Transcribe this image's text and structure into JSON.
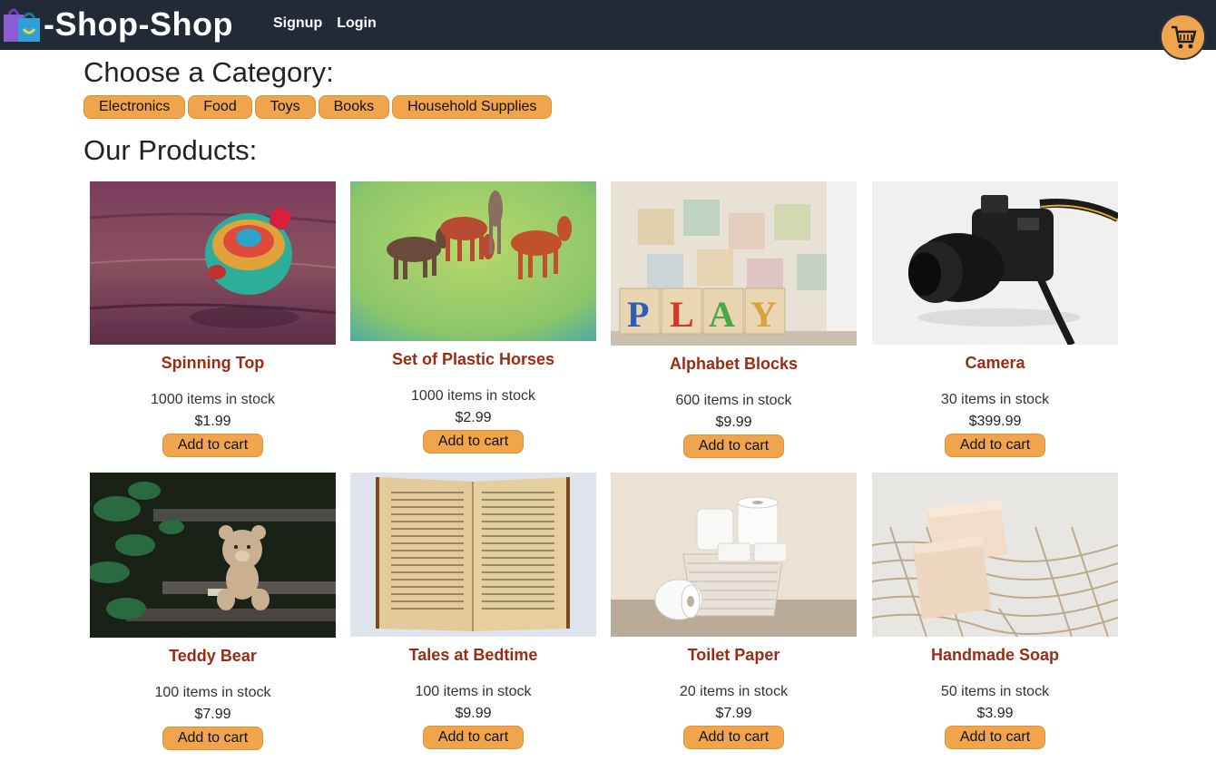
{
  "brand": {
    "emoji_icon": "shopping-bags-icon",
    "title": "-Shop-Shop"
  },
  "nav": {
    "signup": "Signup",
    "login": "Login"
  },
  "cart": {
    "icon": "shopping-cart-icon"
  },
  "category_title": "Choose a Category:",
  "categories": [
    "Electronics",
    "Food",
    "Toys",
    "Books",
    "Household Supplies"
  ],
  "products_title": "Our Products:",
  "products": [
    {
      "name": "Spinning Top",
      "stock": "1000 items in stock",
      "price": "$1.99",
      "cta": "Add to cart"
    },
    {
      "name": "Set of Plastic Horses",
      "stock": "1000 items in stock",
      "price": "$2.99",
      "cta": "Add to cart"
    },
    {
      "name": "Alphabet Blocks",
      "stock": "600 items in stock",
      "price": "$9.99",
      "cta": "Add to cart"
    },
    {
      "name": "Camera",
      "stock": "30 items in stock",
      "price": "$399.99",
      "cta": "Add to cart"
    },
    {
      "name": "Teddy Bear",
      "stock": "100 items in stock",
      "price": "$7.99",
      "cta": "Add to cart"
    },
    {
      "name": "Tales at Bedtime",
      "stock": "100 items in stock",
      "price": "$9.99",
      "cta": "Add to cart"
    },
    {
      "name": "Toilet Paper",
      "stock": "20 items in stock",
      "price": "$7.99",
      "cta": "Add to cart"
    },
    {
      "name": "Handmade Soap",
      "stock": "50 items in stock",
      "price": "$3.99",
      "cta": "Add to cart"
    }
  ],
  "colors": {
    "navbar": "#212a36",
    "accent": "#f0a44c",
    "product_name": "#9b2b12"
  }
}
